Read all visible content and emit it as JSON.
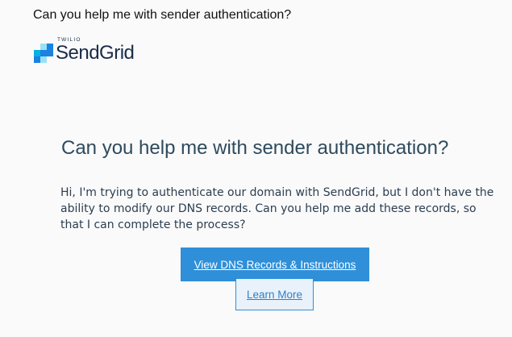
{
  "email": {
    "subject": "Can you help me with sender authentication?"
  },
  "logo": {
    "brand_small": "TWILIO",
    "brand_name": "SendGrid",
    "colors": {
      "dark": "#1a82e2",
      "light": "#99e1f4",
      "mid": "#00b2e3"
    }
  },
  "main": {
    "heading": "Can you help me with sender authentication?",
    "body": "Hi, I'm trying to authenticate our domain with SendGrid, but I don't have the ability to modify our DNS records. Can you help me add these records, so that I can complete the process?",
    "primary_button": "View DNS Records & Instructions",
    "secondary_button": "Learn More"
  },
  "colors": {
    "accent": "#2f8fd8",
    "heading": "#2e4a5c",
    "body_text": "#2c3e50"
  }
}
